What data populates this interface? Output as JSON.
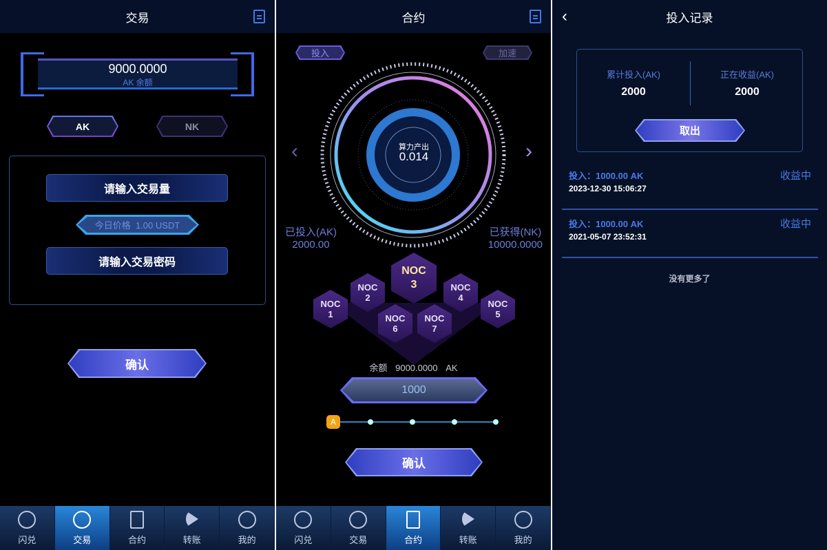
{
  "trade": {
    "title": "交易",
    "balance": "9000.0000",
    "balance_label": "AK 余额",
    "token_ak": "AK",
    "token_nk": "NK",
    "amount_placeholder": "请输入交易量",
    "price_label": "今日价格",
    "price_value": "1.00 USDT",
    "password_placeholder": "请输入交易密码",
    "confirm": "确认"
  },
  "contract": {
    "title": "合约",
    "invest_tab": "投入",
    "speed_tab": "加速",
    "gauge_label": "算力产出",
    "gauge_value": "0.014",
    "invested_label": "已投入(AK)",
    "invested_value": "2000.00",
    "earned_label": "已获得(NK)",
    "earned_value": "10000.0000",
    "nodes": [
      {
        "name": "NOC",
        "num": "1"
      },
      {
        "name": "NOC",
        "num": "2"
      },
      {
        "name": "NOC",
        "num": "3"
      },
      {
        "name": "NOC",
        "num": "4"
      },
      {
        "name": "NOC",
        "num": "5"
      },
      {
        "name": "NOC",
        "num": "6"
      },
      {
        "name": "NOC",
        "num": "7"
      }
    ],
    "balance_label": "余额",
    "balance_value": "9000.0000",
    "balance_unit": "AK",
    "amount": "1000",
    "slider_badge": "A",
    "slider_level": 0,
    "confirm": "确认"
  },
  "records": {
    "title": "投入记录",
    "total_label": "累计投入(AK)",
    "total_value": "2000",
    "earning_label": "正在收益(AK)",
    "earning_value": "2000",
    "withdraw": "取出",
    "items": [
      {
        "label": "投入：",
        "amount": "1000.00 AK",
        "time": "2023-12-30 15:06:27",
        "status": "收益中"
      },
      {
        "label": "投入：",
        "amount": "1000.00 AK",
        "time": "2021-05-07 23:52:31",
        "status": "收益中"
      }
    ],
    "no_more": "没有更多了"
  },
  "tabs": [
    "闪兑",
    "交易",
    "合约",
    "转账",
    "我的"
  ],
  "colors": {
    "accent": "#3f7bea",
    "highlight": "#2a86d8",
    "purple": "#4a2a86"
  }
}
